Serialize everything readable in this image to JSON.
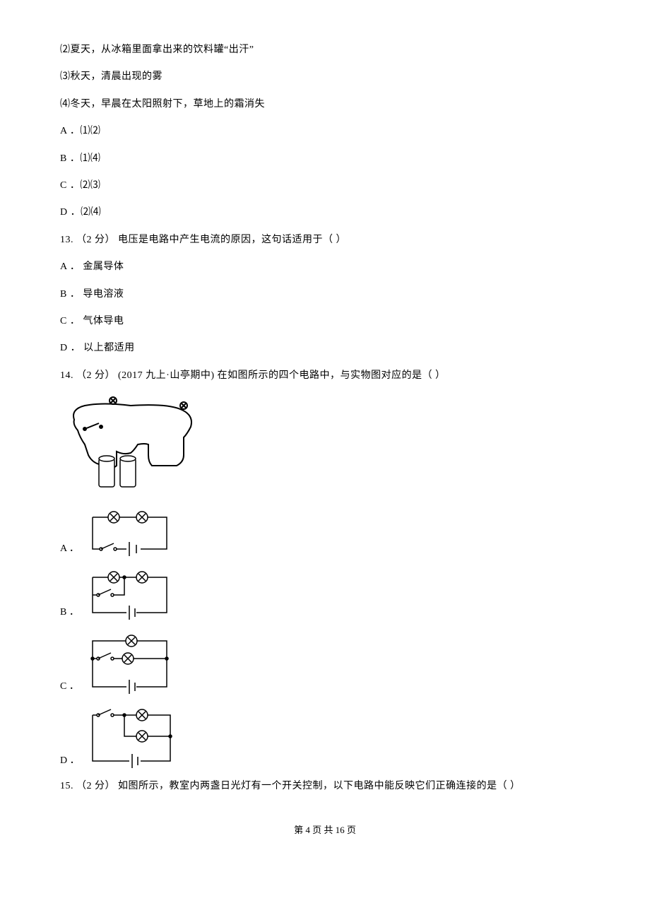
{
  "lines": {
    "l2": "⑵夏天，从冰箱里面拿出来的饮料罐“出汗”",
    "l3": "⑶秋天，清晨出现的雾",
    "l4": "⑷冬天，早晨在太阳照射下，草地上的霜消失",
    "optA": "A ．⑴⑵",
    "optB": "B ．⑴⑷",
    "optC": "C ．⑵⑶",
    "optD": "D ．⑵⑷"
  },
  "q13": {
    "stem": "13.  （2 分） 电压是电路中产生电流的原因，这句话适用于（    ）",
    "A": "A ． 金属导体",
    "B": "B ． 导电溶液",
    "C": "C ． 气体导电",
    "D": "D ． 以上都适用"
  },
  "q14": {
    "stem": "14.  （2 分） (2017 九上·山亭期中) 在如图所示的四个电路中，与实物图对应的是（    ）",
    "A": "A ．",
    "B": "B ．",
    "C": "C ．",
    "D": "D ．"
  },
  "q15": {
    "stem": "15.  （2 分） 如图所示，教室内两盏日光灯有一个开关控制，以下电路中能反映它们正确连接的是（    ）"
  },
  "footer": "第 4 页 共 16 页"
}
